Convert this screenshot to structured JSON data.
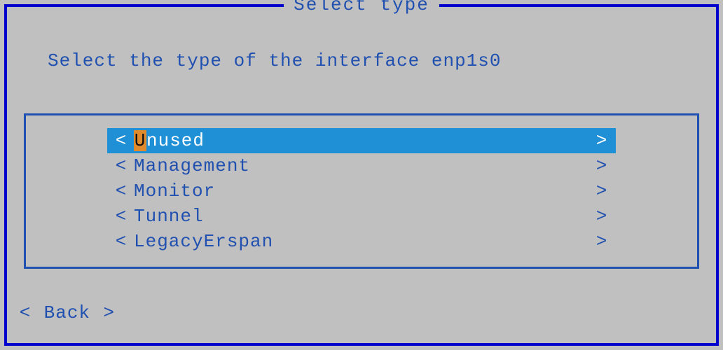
{
  "title": "Select type",
  "prompt": "Select the type of the interface enp1s0",
  "items": [
    {
      "hotkey": "U",
      "rest": "nused",
      "selected": true
    },
    {
      "hotkey": "",
      "rest": "Management",
      "selected": false
    },
    {
      "hotkey": "",
      "rest": "Monitor",
      "selected": false
    },
    {
      "hotkey": "",
      "rest": "Tunnel",
      "selected": false
    },
    {
      "hotkey": "",
      "rest": "LegacyErspan",
      "selected": false
    }
  ],
  "back_label": "Back",
  "bracket_left": "<",
  "bracket_right": ">"
}
